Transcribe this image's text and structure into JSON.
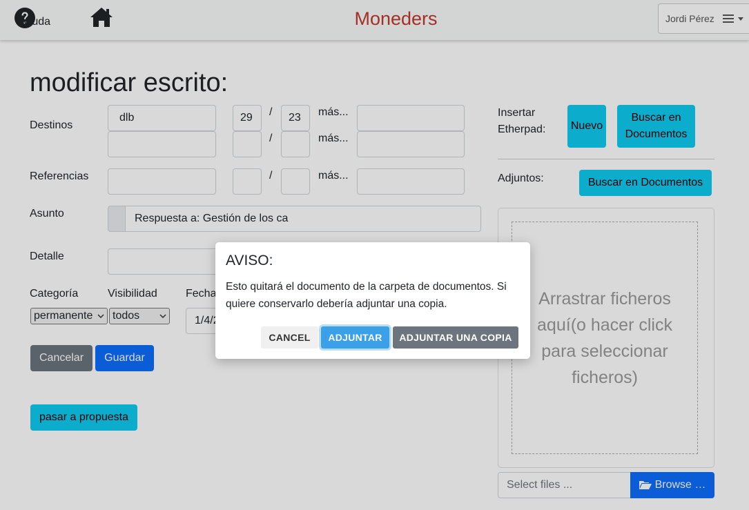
{
  "nav": {
    "help_label": "Ayuda",
    "home_label": "d",
    "brand": "Moneders",
    "user_name": "Jordi Pérez"
  },
  "form": {
    "title": "modificar escrito:",
    "destinos_label": "Destinos",
    "destinos": [
      {
        "name": "dlb",
        "num": "29",
        "year": "23",
        "mas": "más...",
        "extra": ""
      },
      {
        "name": "",
        "num": "",
        "year": "",
        "mas": "más...",
        "extra": ""
      }
    ],
    "slash": "/",
    "referencias_label": "Referencias",
    "referencias": {
      "name": "",
      "num": "",
      "year": "",
      "mas": "más...",
      "extra": ""
    },
    "asunto_label": "Asunto",
    "asunto_value": "Respuesta a: Gestión de los ca",
    "detalle_label": "Detalle",
    "detalle_value": "",
    "categoria_label": "Categoría",
    "categoria_value": "permanente",
    "visibilidad_label": "Visibilidad",
    "visibilidad_value": "todos",
    "fecha_label": "Fecha",
    "fecha_value": "1/4/2",
    "cancel_button": "Cancelar",
    "save_button": "Guardar",
    "propuesta_button": "pasar a propuesta"
  },
  "side": {
    "etherpad_label": "Insertar Etherpad:",
    "nuevo_button": "Nuevo",
    "buscar_docs_button": "Buscar en Documentos",
    "adjuntos_label": "Adjuntos:",
    "buscar_docs_button2": "Buscar en Documentos",
    "dropzone_text": "Arrastrar ficheros aquí(o hacer click para seleccionar ficheros)",
    "file_placeholder": "Select files ...",
    "browse_button": "Browse …"
  },
  "modal": {
    "title": "AVISO:",
    "text": "Esto quitará el documento de la carpeta de documentos. Si quiere conservarlo debería adjuntar una copia.",
    "cancel": "CANCEL",
    "adjuntar": "ADJUNTAR",
    "adjuntar_copia": "ADJUNTAR UNA COPIA"
  },
  "colors": {
    "brand": "#c0392b",
    "primary": "#0d6efd",
    "info": "#0dcaf0",
    "secondary": "#6c757d"
  }
}
